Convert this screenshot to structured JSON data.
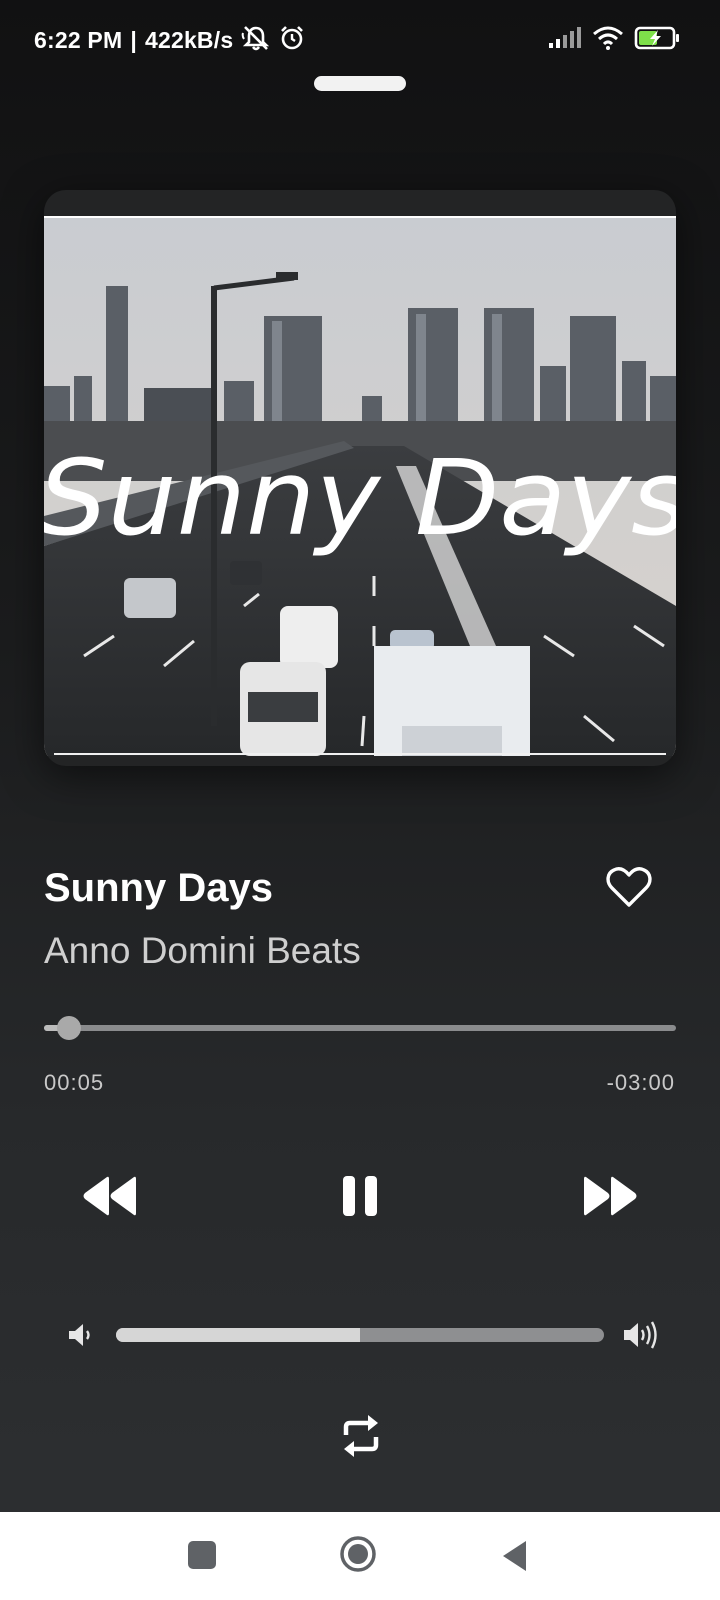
{
  "status_bar": {
    "time": "6:22 PM",
    "separator": "|",
    "network_speed": "422kB/s",
    "icons": [
      "notifications-muted-icon",
      "alarm-icon",
      "signal-icon",
      "wifi-icon",
      "battery-charging-icon"
    ]
  },
  "player": {
    "album_art_text": "Sunny Days",
    "title": "Sunny Days",
    "artist": "Anno Domini Beats",
    "liked": false,
    "progress_fraction": 0.04,
    "elapsed": "00:05",
    "remaining": "-03:00",
    "is_playing": true,
    "volume_fraction": 0.5,
    "icons": {
      "like": "heart-outline-icon",
      "rewind": "rewind-icon",
      "pause": "pause-icon",
      "forward": "fast-forward-icon",
      "volume_low": "volume-low-icon",
      "volume_high": "volume-high-icon",
      "repeat": "repeat-icon"
    }
  },
  "nav_bar": {
    "icons": [
      "recents-square-icon",
      "home-circle-icon",
      "back-triangle-icon"
    ]
  },
  "colors": {
    "background_top": "#111112",
    "background_bottom": "#2c2e30",
    "accent_text": "#ffffff",
    "secondary_text": "#cfcfcf",
    "seek_track": "#8a8b8d",
    "battery_charge": "#7ee04a"
  }
}
